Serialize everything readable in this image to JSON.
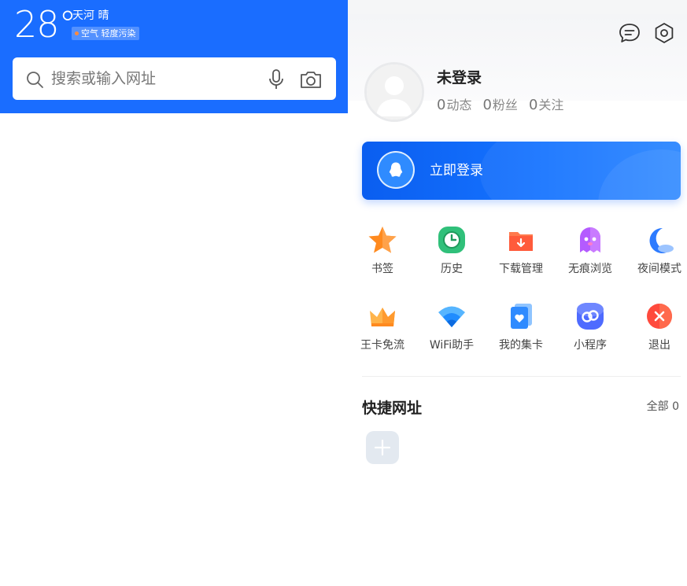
{
  "weather": {
    "temperature": "28°",
    "location_weather": "天河 晴",
    "air_quality": "空气 轻度污染",
    "air_color": "#ff8a3d"
  },
  "search": {
    "placeholder": "搜索或输入网址",
    "icons": [
      "search-icon",
      "mic-icon",
      "camera-icon"
    ]
  },
  "header_icons": [
    "message-icon",
    "gear-icon"
  ],
  "profile": {
    "username": "未登录",
    "stats": [
      {
        "num": "0",
        "label": "动态"
      },
      {
        "num": "0",
        "label": "粉丝"
      },
      {
        "num": "0",
        "label": "关注"
      }
    ]
  },
  "login": {
    "label": "立即登录",
    "icon": "qq-penguin-icon"
  },
  "menu_items": [
    {
      "label": "书签",
      "icon": "star-icon",
      "color": "#ff8a1f"
    },
    {
      "label": "历史",
      "icon": "clock-icon",
      "color": "#2bb673"
    },
    {
      "label": "下载管理",
      "icon": "download-folder-icon",
      "color": "#ff5b3b"
    },
    {
      "label": "无痕浏览",
      "icon": "ghost-icon",
      "color": "#b45bff"
    },
    {
      "label": "夜间模式",
      "icon": "moon-icon",
      "color": "#2d7bff"
    },
    {
      "label": "王卡免流",
      "icon": "crown-icon",
      "color": "#ff9a2e"
    },
    {
      "label": "WiFi助手",
      "icon": "wifi-icon",
      "color": "#1f8cff"
    },
    {
      "label": "我的集卡",
      "icon": "card-icon",
      "color": "#2f8bff"
    },
    {
      "label": "小程序",
      "icon": "mini-program-icon",
      "color": "#4e6bff"
    },
    {
      "label": "退出",
      "icon": "close-circle-icon",
      "color": "#ff4a3d"
    }
  ],
  "quick": {
    "title": "快捷网址",
    "all_label": "全部 0",
    "add_icon": "plus-icon"
  },
  "colors": {
    "brand_blue": "#1a6dff"
  }
}
